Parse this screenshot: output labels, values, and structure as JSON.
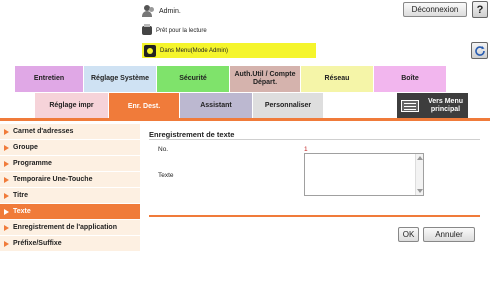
{
  "header": {
    "admin_label": "Admin.",
    "logout_label": "Déconnexion",
    "help_label": "?",
    "status_text": "Prêt pour la lecture",
    "mode_text": "Dans Menu(Mode Admin)"
  },
  "main_tabs": [
    {
      "label": "Entretien",
      "color": "#e0a8e6"
    },
    {
      "label": "Réglage Système",
      "color": "#cfe2f3"
    },
    {
      "label": "Sécurité",
      "color": "#7fe36b"
    },
    {
      "label": "Auth.Util / Compte Départ.",
      "color": "#d5b3ad"
    },
    {
      "label": "Réseau",
      "color": "#f5f5a8"
    },
    {
      "label": "Boîte",
      "color": "#f2b6ee"
    }
  ],
  "sub_tabs": [
    {
      "label": "Réglage impr",
      "color": "#f6d3d9"
    },
    {
      "label": "Enr. Dest.",
      "color": "#f07b3a",
      "active": true
    },
    {
      "label": "Assistant",
      "color": "#bcb8d0"
    },
    {
      "label": "Personnaliser",
      "color": "#dedede"
    }
  ],
  "menu_button": {
    "label": "Vers Menu principal"
  },
  "left_menu": [
    {
      "label": "Carnet d'adresses"
    },
    {
      "label": "Groupe"
    },
    {
      "label": "Programme"
    },
    {
      "label": "Temporaire Une-Touche"
    },
    {
      "label": "Titre"
    },
    {
      "label": "Texte",
      "active": true
    },
    {
      "label": "Enregistrement de l'application"
    },
    {
      "label": "Préfixe/Suffixe"
    }
  ],
  "content": {
    "title": "Enregistrement de texte",
    "no_label": "No.",
    "no_value": "1",
    "texte_label": "Texte",
    "texte_value": ""
  },
  "actions": {
    "ok_label": "OK",
    "cancel_label": "Annuler"
  },
  "colors": {
    "accent": "#f07b3a",
    "mode_bar": "#f5f52c"
  }
}
